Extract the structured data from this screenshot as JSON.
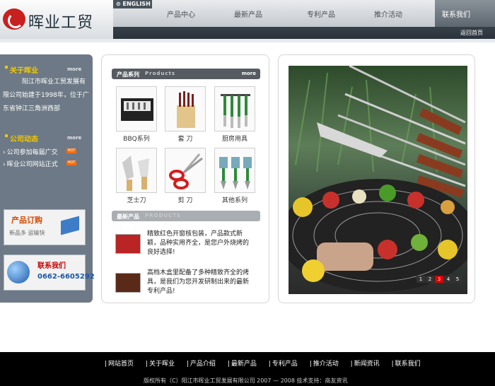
{
  "header": {
    "logo_text": "晖业工贸",
    "english_link": "ENGLISH",
    "nav": [
      "产品中心",
      "最新产品",
      "专利产品",
      "推介活动",
      "联系我们"
    ],
    "back_home": "返回首页"
  },
  "sidebar": {
    "about": {
      "title": "关于晖业",
      "more": "more",
      "text": "阳江市晖业工贸发展有限公司始建于1998年，位于广东省钟江三角洲西部"
    },
    "news": {
      "title": "公司动态",
      "more": "more",
      "items": [
        {
          "label": "公司参加每届广交",
          "badge": "HOT"
        },
        {
          "label": "晖业公司网站正式",
          "badge": "HOT"
        }
      ]
    },
    "order": {
      "title": "产品订购",
      "subtitle": "新品多 运输快"
    },
    "contact": {
      "title": "联系我们",
      "phone": "0662-6605292"
    }
  },
  "products": {
    "title": "产品系列",
    "title_en": "Products",
    "more": "more",
    "items": [
      "BBQ系列",
      "套 刀",
      "厨房用具",
      "芝士刀",
      "剪 刀",
      "其他系列"
    ]
  },
  "latest": {
    "title": "最新产品",
    "title_en": "PRODUCTS",
    "items": [
      "精致红色开窗核包装，产品款式新颖，品种实用齐全，是您户外烧烤的良好选择!",
      "高档木盒里配备了多种精致齐全的烤具，是我们为您开发研制出来的最新专利产品!"
    ]
  },
  "slideshow": {
    "pages": [
      "1",
      "2",
      "3",
      "4",
      "5"
    ],
    "active_page": "3"
  },
  "footer": {
    "links": [
      "网站首页",
      "关于晖业",
      "产品介绍",
      "最新产品",
      "专利产品",
      "推介活动",
      "新闻资讯",
      "联系我们"
    ],
    "copyright": "版权所有（C）阳江市晖业工贸发展有限公司 2007 — 2008   技术支持：商友资讯"
  },
  "colors": {
    "header_dark": "#3a434c",
    "sidebar": "#6d7986",
    "accent_yellow": "#f1c700",
    "hot_orange": "#ff6a00",
    "pager_active": "#e00000"
  }
}
